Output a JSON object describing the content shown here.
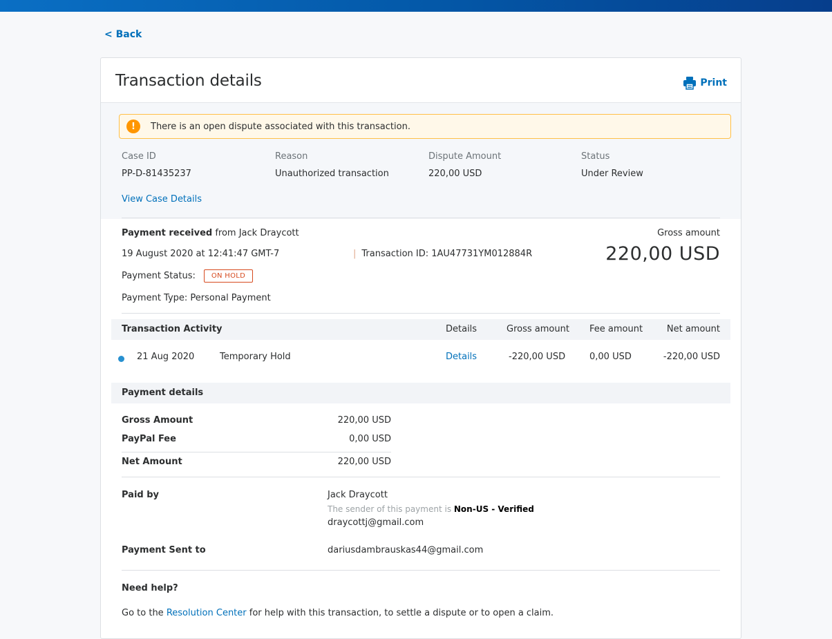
{
  "nav": {
    "back_label": "< Back"
  },
  "header": {
    "title": "Transaction details",
    "print_label": "Print"
  },
  "alert": {
    "text": "There is an open dispute associated with this transaction."
  },
  "dispute": {
    "columns": [
      {
        "label": "Case ID",
        "value": "PP-D-81435237"
      },
      {
        "label": "Reason",
        "value": "Unauthorized transaction"
      },
      {
        "label": "Dispute Amount",
        "value": "220,00 USD"
      },
      {
        "label": "Status",
        "value": "Under Review"
      }
    ],
    "view_case_label": "View Case Details"
  },
  "payment": {
    "received_prefix": "Payment received",
    "received_from": " from Jack Draycott",
    "date": "19 August 2020 at 12:41:47 GMT-7",
    "transaction_id": "Transaction ID: 1AU47731YM012884R",
    "status_label": "Payment Status:",
    "status_badge": "ON HOLD",
    "type": "Payment Type: Personal Payment",
    "gross_label": "Gross amount",
    "gross_value": "220,00 USD"
  },
  "activity": {
    "title": "Transaction Activity",
    "headers": {
      "details": "Details",
      "gross": "Gross amount",
      "fee": "Fee amount",
      "net": "Net amount"
    },
    "rows": [
      {
        "date": "21 Aug 2020",
        "description": "Temporary Hold",
        "details": "Details",
        "gross": "-220,00 USD",
        "fee": "0,00 USD",
        "net": "-220,00 USD"
      }
    ]
  },
  "payment_details": {
    "title": "Payment details",
    "gross_label": "Gross Amount",
    "gross_value": "220,00 USD",
    "fee_label": "PayPal Fee",
    "fee_value": "0,00 USD",
    "net_label": "Net Amount",
    "net_value": "220,00 USD"
  },
  "paid_by": {
    "label": "Paid by",
    "name": "Jack Draycott",
    "sender_note": "The sender of this payment is ",
    "sender_status": "Non-US - Verified",
    "email": "draycottj@gmail.com"
  },
  "sent_to": {
    "label": "Payment Sent to",
    "email": "dariusdambrauskas44@gmail.com"
  },
  "help": {
    "title": "Need help?",
    "text_before": "Go to the ",
    "link": "Resolution Center",
    "text_after": " for help with this transaction, to settle a dispute or to open a claim."
  },
  "colors": {
    "brand": "#0070ba",
    "warning": "#ff9600",
    "hold": "#d64a1e"
  }
}
